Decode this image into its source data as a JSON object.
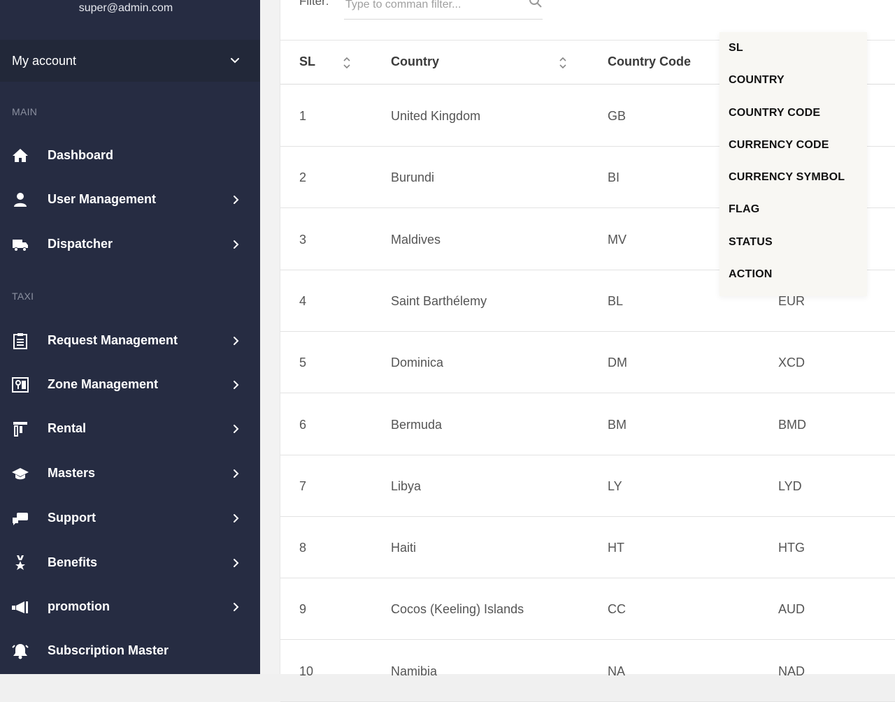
{
  "sidebar": {
    "user_email": "super@admin.com",
    "account_label": "My account",
    "section_main": "MAIN",
    "section_taxi": "TAXI",
    "items": [
      {
        "label": "Dashboard",
        "icon": "home-icon",
        "has_arrow": false
      },
      {
        "label": "User Management",
        "icon": "user-icon",
        "has_arrow": true
      },
      {
        "label": "Dispatcher",
        "icon": "truck-icon",
        "has_arrow": true
      },
      {
        "label": "Request Management",
        "icon": "clipboard-icon",
        "has_arrow": true
      },
      {
        "label": "Zone Management",
        "icon": "map-icon",
        "has_arrow": true
      },
      {
        "label": "Rental",
        "icon": "rental-icon",
        "has_arrow": true
      },
      {
        "label": "Masters",
        "icon": "graduation-cap-icon",
        "has_arrow": true
      },
      {
        "label": "Support",
        "icon": "support-icon",
        "has_arrow": true
      },
      {
        "label": "Benefits",
        "icon": "award-icon",
        "has_arrow": true
      },
      {
        "label": "promotion",
        "icon": "megaphone-icon",
        "has_arrow": true
      },
      {
        "label": "Subscription Master",
        "icon": "bell-icon",
        "has_arrow": false
      }
    ]
  },
  "filter": {
    "label": "Filter:",
    "placeholder": "Type to comman filter..."
  },
  "table": {
    "headers": {
      "sl": "SL",
      "country": "Country",
      "country_code": "Country Code"
    },
    "rows": [
      {
        "sl": "1",
        "country": "United Kingdom",
        "code": "GB",
        "currency": ""
      },
      {
        "sl": "2",
        "country": "Burundi",
        "code": "BI",
        "currency": ""
      },
      {
        "sl": "3",
        "country": "Maldives",
        "code": "MV",
        "currency": ""
      },
      {
        "sl": "4",
        "country": "Saint Barthélemy",
        "code": "BL",
        "currency": "EUR"
      },
      {
        "sl": "5",
        "country": "Dominica",
        "code": "DM",
        "currency": "XCD"
      },
      {
        "sl": "6",
        "country": "Bermuda",
        "code": "BM",
        "currency": "BMD"
      },
      {
        "sl": "7",
        "country": "Libya",
        "code": "LY",
        "currency": "LYD"
      },
      {
        "sl": "8",
        "country": "Haiti",
        "code": "HT",
        "currency": "HTG"
      },
      {
        "sl": "9",
        "country": "Cocos (Keeling) Islands",
        "code": "CC",
        "currency": "AUD"
      },
      {
        "sl": "10",
        "country": "Namibia",
        "code": "NA",
        "currency": "NAD"
      }
    ]
  },
  "column_menu": {
    "items": [
      "SL",
      "COUNTRY",
      "COUNTRY CODE",
      "CURRENCY CODE",
      "CURRENCY SYMBOL",
      "FLAG",
      "STATUS",
      "ACTION"
    ]
  },
  "colors": {
    "sidebar_bg": "#262c42",
    "account_bg": "#222839",
    "menu_bg": "#f8f7f3"
  }
}
